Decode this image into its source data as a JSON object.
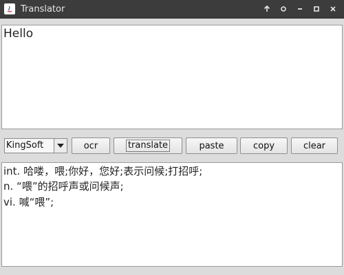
{
  "window": {
    "title": "Translator",
    "controls": {
      "keep_above_icon": "arrow-up-icon",
      "sticky_icon": "circle-icon",
      "minimize_icon": "minimize-icon",
      "maximize_icon": "maximize-icon",
      "close_icon": "close-icon"
    }
  },
  "input": {
    "text": "Hello"
  },
  "toolbar": {
    "engine_selected": "KingSoft",
    "ocr_label": "ocr",
    "translate_label": "translate",
    "paste_label": "paste",
    "copy_label": "copy",
    "clear_label": "clear"
  },
  "output": {
    "lines": [
      "int. 哈喽，喂;你好，您好;表示问候;打招呼;",
      "n. “喂”的招呼声或问候声;",
      "vi. 喊“喂”;"
    ]
  }
}
